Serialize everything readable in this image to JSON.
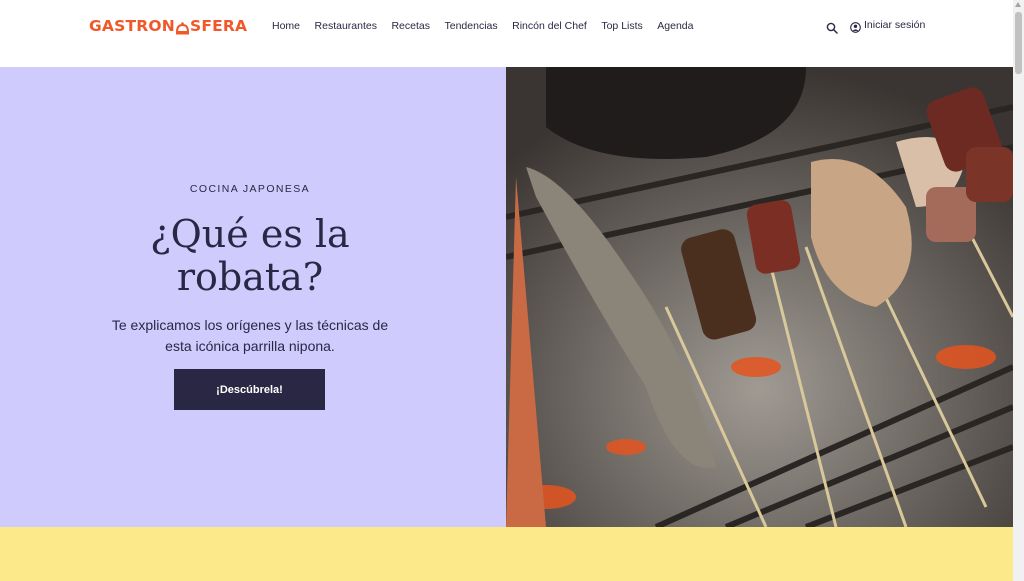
{
  "header": {
    "logo_text_left": "GASTRON",
    "logo_text_right": "SFERA",
    "nav": [
      "Home",
      "Restaurantes",
      "Recetas",
      "Tendencias",
      "Rincón del Chef",
      "Top Lists",
      "Agenda"
    ],
    "login_label": "Iniciar sesión"
  },
  "hero": {
    "eyebrow": "COCINA JAPONESA",
    "title_line1": "¿Qué es la",
    "title_line2": "robata?",
    "subtitle": "Te explicamos los orígenes y las técnicas de esta icónica parrilla nipona.",
    "cta_label": "¡Descúbrela!"
  },
  "colors": {
    "brand": "#f0582a",
    "hero_bg": "#cfcbfd",
    "ink": "#2a2744",
    "band": "#fce98a"
  },
  "icons": {
    "search": "search-icon",
    "user": "user-circle-icon"
  }
}
